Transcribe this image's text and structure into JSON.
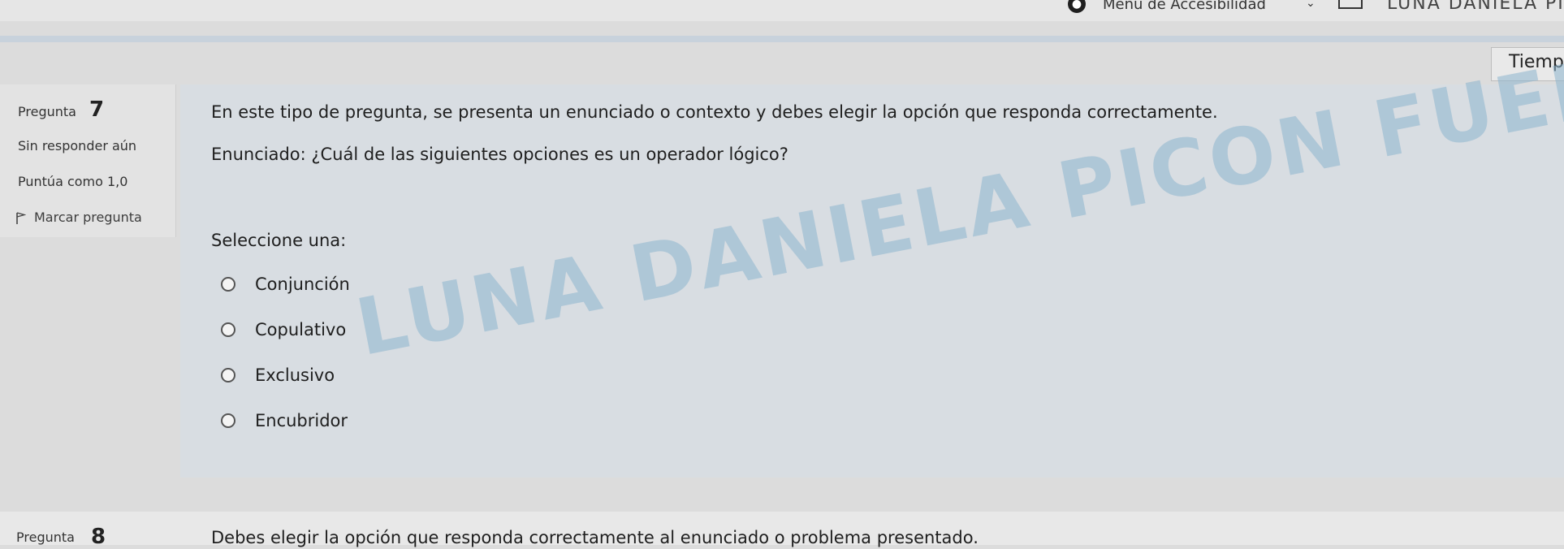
{
  "header": {
    "accessibility_menu": "Menú de Accesibilidad",
    "user_name": "LUNA DANIELA PICO",
    "timer_label": "Tiempo"
  },
  "question": {
    "label": "Pregunta",
    "number": "7",
    "state": "Sin responder aún",
    "grade": "Puntúa como 1,0",
    "flag": "Marcar pregunta",
    "text": "En este tipo de pregunta, se presenta un enunciado o contexto y debes elegir la opción que responda correctamente.",
    "enunciado": "Enunciado: ¿Cuál de las siguientes opciones es un operador lógico?",
    "prompt": "Seleccione una:",
    "options": [
      "Conjunción",
      "Copulativo",
      "Exclusivo",
      "Encubridor"
    ]
  },
  "watermark": "LUNA DANIELA PICON FUENTES",
  "next_question": {
    "label": "Pregunta",
    "number": "8",
    "text": "Debes elegir la opción que responda correctamente al enunciado o problema presentado."
  },
  "icons": {
    "accessibility": "accessibility-icon",
    "flag": "flag-icon",
    "mail": "mail-icon"
  }
}
